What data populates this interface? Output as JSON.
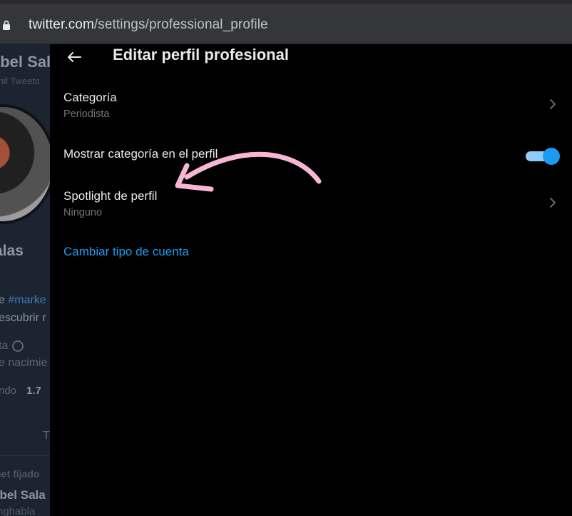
{
  "browser": {
    "url_domain": "twitter.com",
    "url_path": "/settings/professional_profile"
  },
  "background_profile": {
    "name_top": "abel Sal",
    "tweets_count_label": "nil Tweets",
    "name": "alas",
    "bio_line1_prefix": "e ",
    "bio_line1_hashtag": "#marke",
    "bio_line2": "escubrir r",
    "meta_line1": "ta",
    "meta_line2": "e nacimie",
    "stat_label": "ndo",
    "stat_value": "1.7",
    "tab_label": "T",
    "pinned_label": "eet fijado",
    "pinned_author": "abel Sala",
    "pinned_handle": "nghabla"
  },
  "panel": {
    "title": "Editar perfil profesional",
    "category": {
      "label": "Categoría",
      "value": "Periodista"
    },
    "show_category": {
      "label": "Mostrar categoría en el perfil",
      "enabled": true
    },
    "spotlight": {
      "label": "Spotlight de perfil",
      "value": "Ninguno"
    },
    "change_account_link": "Cambiar tipo de cuenta"
  },
  "colors": {
    "accent": "#1d9bf0",
    "annotation_arrow": "#f7b6d2"
  },
  "icons": {
    "back": "arrow-left-icon",
    "chevron": "chevron-right-icon",
    "lock": "lock-icon"
  }
}
